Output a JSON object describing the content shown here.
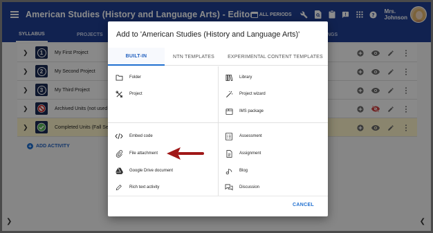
{
  "app": {
    "title": "American Studies (History and Language Arts) - Editor",
    "periods_label": "ALL PERIODS",
    "user_name_line1": "Mrs.",
    "user_name_line2": "Johnson"
  },
  "tabs": [
    {
      "label": "SYLLABUS"
    },
    {
      "label": "PROJECTS"
    },
    {
      "label": "NGS"
    }
  ],
  "units": [
    {
      "number": "1",
      "title": "My First Project"
    },
    {
      "number": "2",
      "title": "My Second Project"
    },
    {
      "number": "3",
      "title": "My Third Project"
    },
    {
      "number": "",
      "title": "Archived Units (not used"
    },
    {
      "number": "",
      "title": "Completed Units (Fall Se"
    }
  ],
  "add_activity_label": "ADD ACTIVITY",
  "dialog": {
    "title": "Add to 'American Studies (History and Language Arts)'",
    "tabs": [
      {
        "label": "BUILT-IN"
      },
      {
        "label": "NTN TEMPLATES"
      },
      {
        "label": "EXPERIMENTAL CONTENT TEMPLATES"
      }
    ],
    "left_top": [
      {
        "label": "Folder",
        "icon": "folder-icon"
      },
      {
        "label": "Project",
        "icon": "tools-icon"
      }
    ],
    "right_top": [
      {
        "label": "Library",
        "icon": "library-icon"
      },
      {
        "label": "Project wizard",
        "icon": "wand-icon"
      },
      {
        "label": "IMS package",
        "icon": "package-icon"
      }
    ],
    "left_bottom": [
      {
        "label": "Embed code",
        "icon": "code-icon"
      },
      {
        "label": "File attachment",
        "icon": "paperclip-icon"
      },
      {
        "label": "Google Drive document",
        "icon": "drive-icon"
      },
      {
        "label": "Rich text activity",
        "icon": "pencil-icon"
      }
    ],
    "right_bottom": [
      {
        "label": "Assessment",
        "icon": "checklist-icon"
      },
      {
        "label": "Assignment",
        "icon": "document-icon"
      },
      {
        "label": "Blog",
        "icon": "blog-icon"
      },
      {
        "label": "Discussion",
        "icon": "chat-icon"
      }
    ],
    "cancel_label": "CANCEL"
  },
  "colors": {
    "appbar": "#1f3f93",
    "accent": "#1f6fd0",
    "arrow": "#a01818",
    "highlight_row": "#fbf3c8"
  }
}
